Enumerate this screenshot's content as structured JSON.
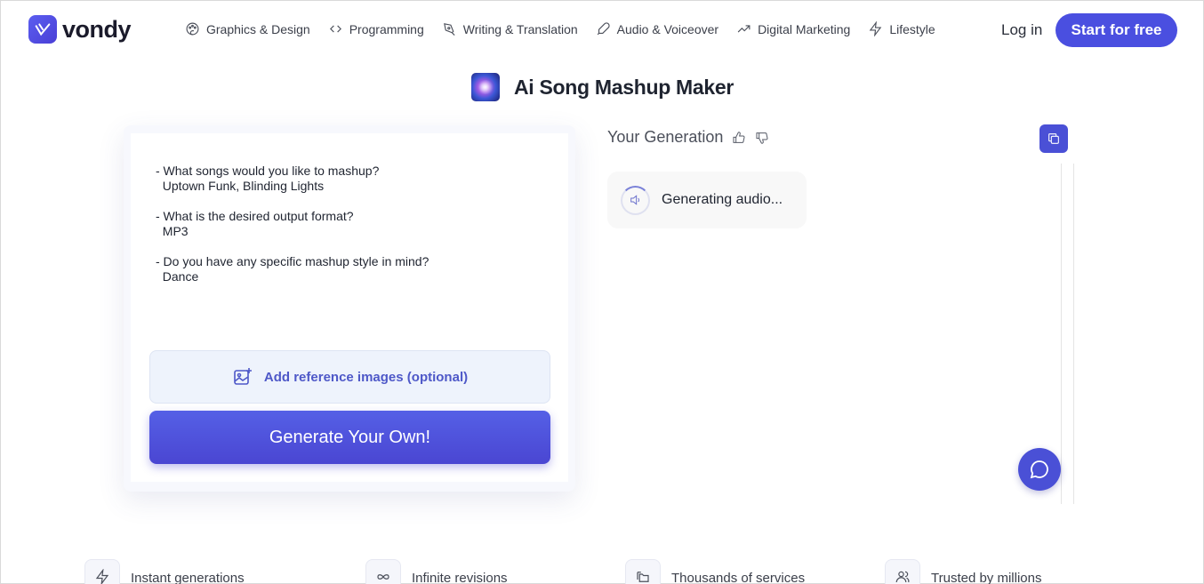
{
  "header": {
    "logo_text": "vondy",
    "nav": [
      {
        "label": "Graphics & Design",
        "icon": "palette-icon"
      },
      {
        "label": "Programming",
        "icon": "code-icon"
      },
      {
        "label": "Writing & Translation",
        "icon": "pen-nib-icon"
      },
      {
        "label": "Audio & Voiceover",
        "icon": "microphone-icon"
      },
      {
        "label": "Digital Marketing",
        "icon": "trending-up-icon"
      },
      {
        "label": "Lifestyle",
        "icon": "lightning-icon"
      }
    ],
    "login_label": "Log in",
    "cta_label": "Start for free"
  },
  "page": {
    "title": "Ai Song Mashup Maker"
  },
  "form": {
    "prompt_text": "- What songs would you like to mashup?\n  Uptown Funk, Blinding Lights\n\n- What is the desired output format?\n  MP3\n\n- Do you have any specific mashup style in mind?\n  Dance",
    "reference_label": "Add reference images (optional)",
    "generate_label": "Generate Your Own!"
  },
  "generation": {
    "title": "Your Generation",
    "status_text": "Generating audio..."
  },
  "features": [
    {
      "label": "Instant generations",
      "icon": "lightning-icon"
    },
    {
      "label": "Infinite revisions",
      "icon": "infinity-icon"
    },
    {
      "label": "Thousands of services",
      "icon": "folders-icon"
    },
    {
      "label": "Trusted by millions",
      "icon": "users-icon"
    }
  ],
  "colors": {
    "accent": "#4a50d6",
    "reference_bg": "#eef3fc",
    "text": "#1f2430"
  }
}
